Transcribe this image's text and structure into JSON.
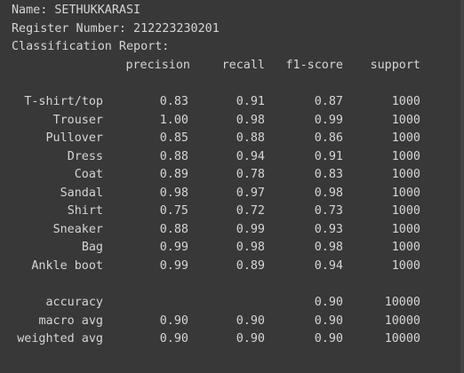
{
  "output": {
    "name_line": "Name: SETHUKKARASI",
    "register_line": "Register Number: 212223230201",
    "report_title": "Classification Report:",
    "headers": [
      "precision",
      "recall",
      "f1-score",
      "support"
    ],
    "rows": [
      {
        "label": "T-shirt/top",
        "precision": "0.83",
        "recall": "0.91",
        "f1": "0.87",
        "support": "1000"
      },
      {
        "label": "Trouser",
        "precision": "1.00",
        "recall": "0.98",
        "f1": "0.99",
        "support": "1000"
      },
      {
        "label": "Pullover",
        "precision": "0.85",
        "recall": "0.88",
        "f1": "0.86",
        "support": "1000"
      },
      {
        "label": "Dress",
        "precision": "0.88",
        "recall": "0.94",
        "f1": "0.91",
        "support": "1000"
      },
      {
        "label": "Coat",
        "precision": "0.89",
        "recall": "0.78",
        "f1": "0.83",
        "support": "1000"
      },
      {
        "label": "Sandal",
        "precision": "0.98",
        "recall": "0.97",
        "f1": "0.98",
        "support": "1000"
      },
      {
        "label": "Shirt",
        "precision": "0.75",
        "recall": "0.72",
        "f1": "0.73",
        "support": "1000"
      },
      {
        "label": "Sneaker",
        "precision": "0.88",
        "recall": "0.99",
        "f1": "0.93",
        "support": "1000"
      },
      {
        "label": "Bag",
        "precision": "0.99",
        "recall": "0.98",
        "f1": "0.98",
        "support": "1000"
      },
      {
        "label": "Ankle boot",
        "precision": "0.99",
        "recall": "0.89",
        "f1": "0.94",
        "support": "1000"
      }
    ],
    "summary": [
      {
        "label": "accuracy",
        "precision": "",
        "recall": "",
        "f1": "0.90",
        "support": "10000"
      },
      {
        "label": "macro avg",
        "precision": "0.90",
        "recall": "0.90",
        "f1": "0.90",
        "support": "10000"
      },
      {
        "label": "weighted avg",
        "precision": "0.90",
        "recall": "0.90",
        "f1": "0.90",
        "support": "10000"
      }
    ]
  }
}
